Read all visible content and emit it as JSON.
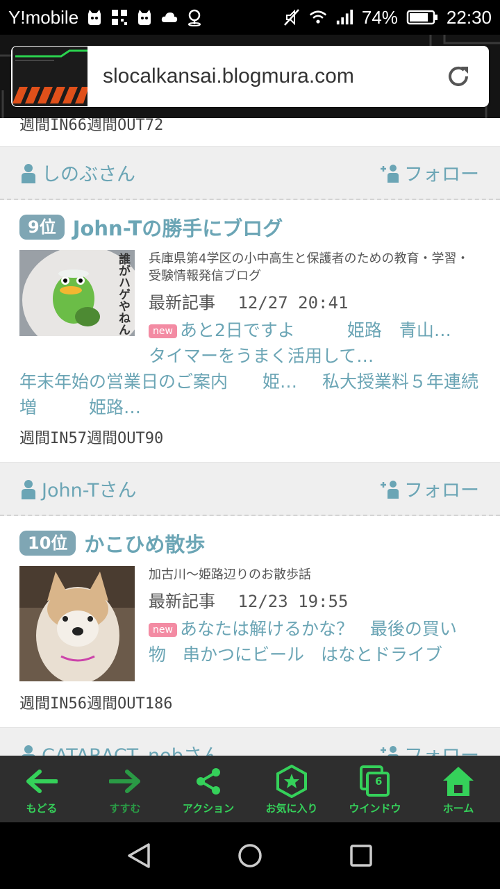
{
  "status_bar": {
    "carrier": "Y!mobile",
    "battery": "74%",
    "time": "22:30"
  },
  "browser": {
    "url": "slocalkansai.blogmura.com"
  },
  "top_partial": {
    "stats": "週間IN66週間OUT72",
    "user": "しのぶさん",
    "follow": "フォロー"
  },
  "entries": [
    {
      "rank": "9位",
      "title": "John-Tの勝手にブログ",
      "description": "兵庫県第4学区の小中高生と保護者のための教育・学習・受験情報発信ブログ",
      "latest_label": "最新記事",
      "latest_date": "12/27 20:41",
      "new_label": "new",
      "articles": [
        "あと2日ですよ　　　姫路　青山…",
        "タイマーをうまく活用して…",
        "年末年始の営業日のご案内　　姫…",
        "私大授業料５年連続増　　　姫路…"
      ],
      "stats": "週間IN57週間OUT90",
      "user": "John-Tさん",
      "follow": "フォロー",
      "thumb_text": "誰がハゲやねん"
    },
    {
      "rank": "10位",
      "title": "かこひめ散歩",
      "description": "加古川～姫路辺りのお散歩話",
      "latest_label": "最新記事",
      "latest_date": "12/23 19:55",
      "new_label": "new",
      "articles": [
        "あなたは解けるかな？",
        "最後の買い物",
        "串かつにビール",
        "はなとドライブ"
      ],
      "stats": "週間IN56週間OUT186",
      "user": "CATARACT. nobさん",
      "follow": "フォロー"
    }
  ],
  "toolbar": {
    "back": "もどる",
    "forward": "すすむ",
    "action": "アクション",
    "favorite": "お気に入り",
    "window": "ウインドウ",
    "window_count": "6",
    "home": "ホーム"
  },
  "colors": {
    "accent": "#6ba5b5",
    "toolbar_green": "#35d15a",
    "new_badge": "#f38ba3"
  }
}
